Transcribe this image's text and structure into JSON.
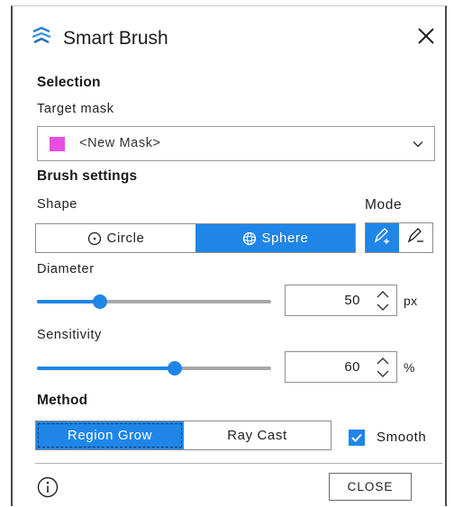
{
  "window": {
    "title": "Smart Brush",
    "app_icon": "smart-brush-icon",
    "close_icon": "close-icon"
  },
  "selection": {
    "heading": "Selection",
    "target_label": "Target mask",
    "target_value": "<New Mask>",
    "mask_color": "#e94ee4"
  },
  "brush": {
    "heading": "Brush settings",
    "shape_label": "Shape",
    "mode_label": "Mode",
    "shapes": [
      {
        "label": "Circle",
        "icon": "circle-icon",
        "active": false
      },
      {
        "label": "Sphere",
        "icon": "sphere-icon",
        "active": true
      }
    ],
    "modes": [
      {
        "icon": "paint-add-icon",
        "active": true
      },
      {
        "icon": "eraser-icon",
        "active": false
      }
    ]
  },
  "diameter": {
    "label": "Diameter",
    "value": "50",
    "unit": "px",
    "slider_fraction": 0.27
  },
  "sensitivity": {
    "label": "Sensitivity",
    "value": "60",
    "unit": "%",
    "slider_fraction": 0.59
  },
  "method": {
    "heading": "Method",
    "options": [
      {
        "label": "Region Grow",
        "active": true
      },
      {
        "label": "Ray Cast",
        "active": false
      }
    ],
    "smooth_label": "Smooth",
    "smooth_checked": true
  },
  "footer": {
    "info_icon": "info-icon",
    "close_label": "CLOSE"
  },
  "colors": {
    "accent": "#1f86e8"
  }
}
